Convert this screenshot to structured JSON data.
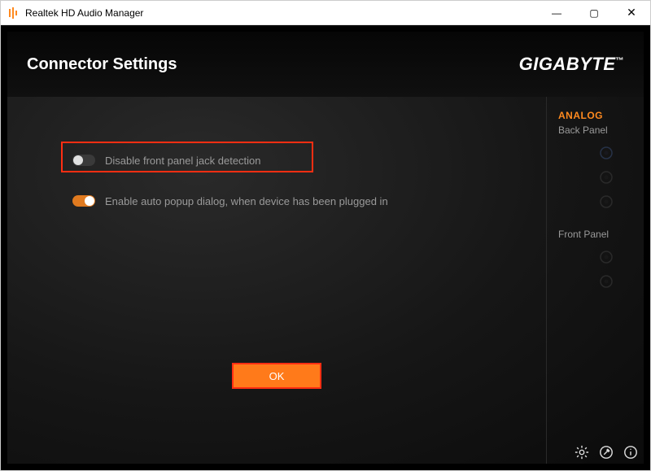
{
  "window": {
    "title": "Realtek HD Audio Manager",
    "minimize": "—",
    "maximize": "▢",
    "close": "✕"
  },
  "header": {
    "title": "Connector Settings",
    "brand": "GIGABYTE",
    "brand_tm": "™"
  },
  "settings": {
    "disable_front_jack": {
      "label": "Disable front panel jack detection",
      "on": false
    },
    "auto_popup": {
      "label": "Enable auto popup dialog, when device has been plugged in",
      "on": true
    }
  },
  "ok_label": "OK",
  "sidebar": {
    "heading": "ANALOG",
    "back_panel_label": "Back Panel",
    "front_panel_label": "Front Panel"
  },
  "footer": {
    "gear": "settings",
    "tool": "tools",
    "info": "info"
  },
  "colors": {
    "accent": "#ff8a1f",
    "button": "#ff7a1a",
    "highlight": "#ff2e12"
  }
}
